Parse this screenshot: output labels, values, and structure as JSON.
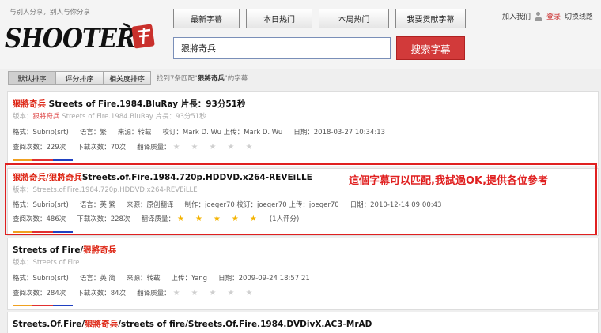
{
  "header": {
    "tagline": "与别人分享，别人与你分享",
    "logo_text": "SHOOTER",
    "nav": [
      "最新字幕",
      "本日热门",
      "本周热门",
      "我要贡献字幕"
    ],
    "user_links": {
      "join": "加入我们",
      "login": "登录",
      "switch": "切换线路"
    },
    "search": {
      "value": "狠將奇兵",
      "button": "搜索字幕"
    }
  },
  "sortbar": {
    "tabs": [
      "默认排序",
      "评分排序",
      "相关度排序"
    ],
    "count_prefix": "找到7条匹配\"",
    "count_keyword": "狠將奇兵",
    "count_suffix": "\"的字幕"
  },
  "results": [
    {
      "title_hl": "狠將奇兵",
      "title_rest": " Streets of Fire.1984.BluRay 片長：93分51秒",
      "version_label": "版本：",
      "version_hl": "狠將奇兵",
      "version_rest": " Streets of Fire.1984.BluRay 片長：93分51秒",
      "row1": [
        "格式：Subrip(srt)",
        "语言：繁",
        "来源：转载",
        "校订：Mark D. Wu 上传：Mark D. Wu",
        "日期：2018-03-27 10:34:13"
      ],
      "views": "查阅次数：229次",
      "downloads": "下载次数：70次",
      "quality_label": "翻译质量：",
      "rating": 0,
      "rating_note": ""
    },
    {
      "title_hl": "狠將奇兵/狠將奇兵",
      "title_rest": "Streets.of.Fire.1984.720p.HDDVD.x264-REVEiLLE",
      "version_label": "版本：",
      "version_hl": "",
      "version_rest": "Streets.of.Fire.1984.720p.HDDVD.x264-REVEiLLE",
      "row1": [
        "格式：Subrip(srt)",
        "语言：英 繁",
        "来源：原创翻译",
        "制作：joeger70 校订：joeger70 上传：joeger70",
        "日期：2010-12-14 09:00:43"
      ],
      "views": "查阅次数：486次",
      "downloads": "下载次数：228次",
      "quality_label": "翻译质量：",
      "rating": 5,
      "rating_note": "(1人评分)"
    },
    {
      "title_hl": "",
      "title_rest": "Streets of Fire/",
      "title_hl2": "狠將奇兵",
      "version_label": "版本：",
      "version_hl": "",
      "version_rest": "Streets of Fire",
      "row1": [
        "格式：Subrip(srt)",
        "语言：英 简",
        "来源：转载",
        "上传：Yang",
        "日期：2009-09-24 18:57:21"
      ],
      "views": "查阅次数：284次",
      "downloads": "下载次数：84次",
      "quality_label": "翻译质量：",
      "rating": 0,
      "rating_note": ""
    },
    {
      "title_pre": "Streets.Of.Fire/",
      "title_hl": "狠將奇兵",
      "title_rest": "/streets of fire/Streets.Of.Fire.1984.DVDivX.AC3-MrAD"
    }
  ],
  "annotation": "這個字幕可以匹配,我試過OK,提供各位參考",
  "colors": {
    "accent": "#d23a3a",
    "highlight": "#e02020",
    "star": "#f4b300"
  }
}
